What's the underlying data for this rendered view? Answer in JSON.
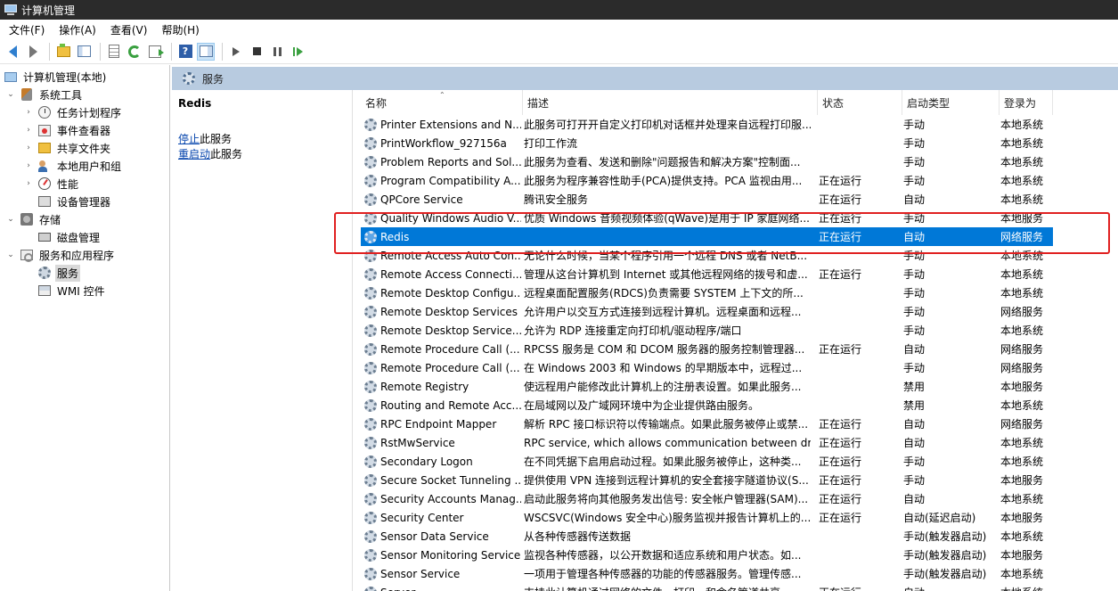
{
  "window": {
    "title": "计算机管理"
  },
  "menu": [
    "文件(F)",
    "操作(A)",
    "查看(V)",
    "帮助(H)"
  ],
  "tree": [
    {
      "label": "计算机管理(本地)",
      "icon": "computer-icon",
      "caret": ""
    },
    {
      "label": "系统工具",
      "icon": "tools-icon",
      "caret": "expanded"
    },
    {
      "label": "任务计划程序",
      "icon": "clock-icon",
      "caret": "collapsed"
    },
    {
      "label": "事件查看器",
      "icon": "event-viewer-icon",
      "caret": "collapsed"
    },
    {
      "label": "共享文件夹",
      "icon": "shared-folder-icon",
      "caret": "collapsed"
    },
    {
      "label": "本地用户和组",
      "icon": "users-icon",
      "caret": "collapsed"
    },
    {
      "label": "性能",
      "icon": "performance-icon",
      "caret": "collapsed"
    },
    {
      "label": "设备管理器",
      "icon": "device-manager-icon",
      "caret": ""
    },
    {
      "label": "存储",
      "icon": "storage-icon",
      "caret": "expanded"
    },
    {
      "label": "磁盘管理",
      "icon": "disk-icon",
      "caret": ""
    },
    {
      "label": "服务和应用程序",
      "icon": "services-apps-icon",
      "caret": "expanded"
    },
    {
      "label": "服务",
      "icon": "gear-icon",
      "caret": "",
      "selected": true
    },
    {
      "label": "WMI 控件",
      "icon": "wmi-icon",
      "caret": ""
    }
  ],
  "pane": {
    "header": "服务"
  },
  "detail": {
    "name": "Redis",
    "stop_link": "停止",
    "stop_suffix": "此服务",
    "restart_link": "重启动",
    "restart_suffix": "此服务"
  },
  "columns": [
    "名称",
    "描述",
    "状态",
    "启动类型",
    "登录为"
  ],
  "rows": [
    {
      "name": "Printer Extensions and N...",
      "desc": "此服务可打开开自定义打印机对话框并处理来自远程打印服...",
      "status": "",
      "startup": "手动",
      "logon": "本地系统"
    },
    {
      "name": "PrintWorkflow_927156a",
      "desc": "打印工作流",
      "status": "",
      "startup": "手动",
      "logon": "本地系统"
    },
    {
      "name": "Problem Reports and Sol...",
      "desc": "此服务为查看、发送和删除\"问题报告和解决方案\"控制面...",
      "status": "",
      "startup": "手动",
      "logon": "本地系统"
    },
    {
      "name": "Program Compatibility A...",
      "desc": "此服务为程序兼容性助手(PCA)提供支持。PCA 监视由用...",
      "status": "正在运行",
      "startup": "手动",
      "logon": "本地系统"
    },
    {
      "name": "QPCore Service",
      "desc": "腾讯安全服务",
      "status": "正在运行",
      "startup": "自动",
      "logon": "本地系统"
    },
    {
      "name": "Quality Windows Audio V...",
      "desc": "优质 Windows 音频视频体验(qWave)是用于 IP 家庭网络...",
      "status": "正在运行",
      "startup": "手动",
      "logon": "本地服务"
    },
    {
      "name": "Redis",
      "desc": "",
      "status": "正在运行",
      "startup": "自动",
      "logon": "网络服务",
      "selected": true
    },
    {
      "name": "Remote Access Auto Con...",
      "desc": "无论什么时候，当某个程序引用一个远程 DNS 或者 NetB...",
      "status": "",
      "startup": "手动",
      "logon": "本地系统"
    },
    {
      "name": "Remote Access Connecti...",
      "desc": "管理从这台计算机到 Internet 或其他远程网络的拨号和虚...",
      "status": "正在运行",
      "startup": "手动",
      "logon": "本地系统"
    },
    {
      "name": "Remote Desktop Configu...",
      "desc": "远程桌面配置服务(RDCS)负责需要 SYSTEM 上下文的所...",
      "status": "",
      "startup": "手动",
      "logon": "本地系统"
    },
    {
      "name": "Remote Desktop Services",
      "desc": "允许用户以交互方式连接到远程计算机。远程桌面和远程...",
      "status": "",
      "startup": "手动",
      "logon": "网络服务"
    },
    {
      "name": "Remote Desktop Service...",
      "desc": "允许为 RDP 连接重定向打印机/驱动程序/端口",
      "status": "",
      "startup": "手动",
      "logon": "本地系统"
    },
    {
      "name": "Remote Procedure Call (...",
      "desc": "RPCSS 服务是 COM 和 DCOM 服务器的服务控制管理器...",
      "status": "正在运行",
      "startup": "自动",
      "logon": "网络服务"
    },
    {
      "name": "Remote Procedure Call (...",
      "desc": "在 Windows 2003 和 Windows 的早期版本中，远程过...",
      "status": "",
      "startup": "手动",
      "logon": "网络服务"
    },
    {
      "name": "Remote Registry",
      "desc": "使远程用户能修改此计算机上的注册表设置。如果此服务...",
      "status": "",
      "startup": "禁用",
      "logon": "本地服务"
    },
    {
      "name": "Routing and Remote Acc...",
      "desc": "在局域网以及广域网环境中为企业提供路由服务。",
      "status": "",
      "startup": "禁用",
      "logon": "本地系统"
    },
    {
      "name": "RPC Endpoint Mapper",
      "desc": "解析 RPC 接口标识符以传输端点。如果此服务被停止或禁...",
      "status": "正在运行",
      "startup": "自动",
      "logon": "网络服务"
    },
    {
      "name": "RstMwService",
      "desc": "RPC service, which allows communication between dr...",
      "status": "正在运行",
      "startup": "自动",
      "logon": "本地系统"
    },
    {
      "name": "Secondary Logon",
      "desc": "在不同凭据下启用启动过程。如果此服务被停止，这种类...",
      "status": "正在运行",
      "startup": "手动",
      "logon": "本地系统"
    },
    {
      "name": "Secure Socket Tunneling ...",
      "desc": "提供使用 VPN 连接到远程计算机的安全套接字隧道协议(S...",
      "status": "正在运行",
      "startup": "手动",
      "logon": "本地服务"
    },
    {
      "name": "Security Accounts Manag...",
      "desc": "启动此服务将向其他服务发出信号: 安全帐户管理器(SAM)...",
      "status": "正在运行",
      "startup": "自动",
      "logon": "本地系统"
    },
    {
      "name": "Security Center",
      "desc": "WSCSVC(Windows 安全中心)服务监视并报告计算机上的...",
      "status": "正在运行",
      "startup": "自动(延迟启动)",
      "logon": "本地服务"
    },
    {
      "name": "Sensor Data Service",
      "desc": "从各种传感器传送数据",
      "status": "",
      "startup": "手动(触发器启动)",
      "logon": "本地系统"
    },
    {
      "name": "Sensor Monitoring Service",
      "desc": "监视各种传感器，以公开数据和适应系统和用户状态。如...",
      "status": "",
      "startup": "手动(触发器启动)",
      "logon": "本地服务"
    },
    {
      "name": "Sensor Service",
      "desc": "一项用于管理各种传感器的功能的传感器服务。管理传感...",
      "status": "",
      "startup": "手动(触发器启动)",
      "logon": "本地系统"
    },
    {
      "name": "Server",
      "desc": "支持此计算机通过网络的文件、打印、和命名管道共享。...",
      "status": "正在运行",
      "startup": "自动",
      "logon": "本地系统"
    }
  ]
}
